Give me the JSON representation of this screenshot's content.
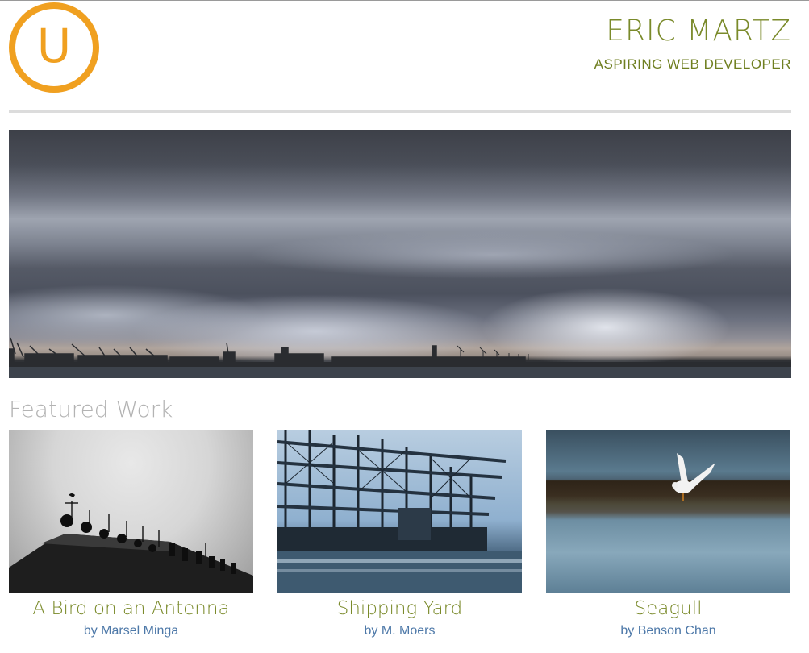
{
  "header": {
    "logo_letter": "U",
    "name": "ERIC MARTZ",
    "tagline": "ASPIRING WEB DEVELOPER"
  },
  "hero": {
    "description": "stormy harbor skyline"
  },
  "featured": {
    "title": "Featured Work",
    "items": [
      {
        "title": "A Bird on an Antenna",
        "credit": "by Marsel Minga"
      },
      {
        "title": "Shipping Yard",
        "credit": "by M. Moers"
      },
      {
        "title": "Seagull",
        "credit": "by Benson Chan"
      }
    ]
  },
  "colors": {
    "accent_orange": "#f0a020",
    "accent_olive": "#7a8a2a",
    "link_blue": "#4d78a8",
    "heading_gray": "#b3b3b3"
  }
}
